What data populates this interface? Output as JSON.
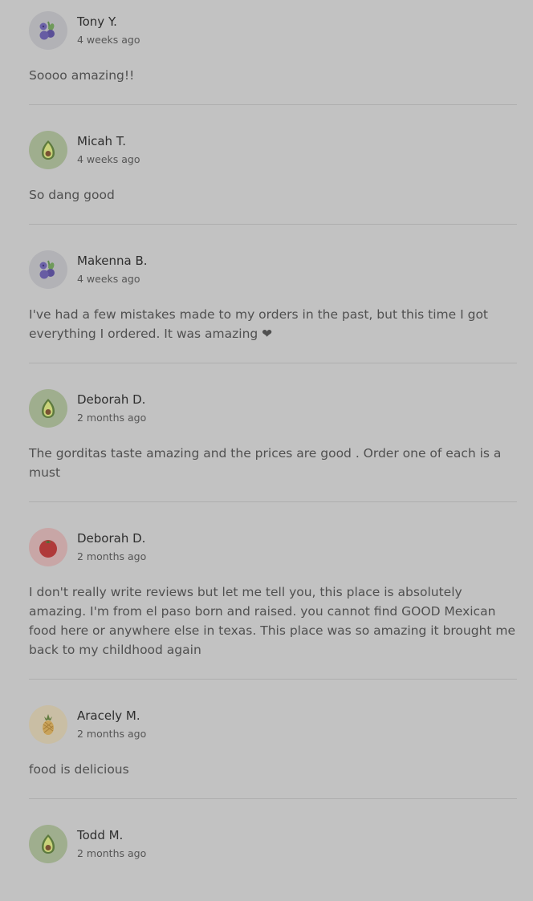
{
  "reviews": [
    {
      "name": "Tony Y.",
      "time": "4 weeks ago",
      "text": "Soooo amazing!!",
      "avatar": "blueberry-icon"
    },
    {
      "name": "Micah T.",
      "time": "4 weeks ago",
      "text": "So dang good",
      "avatar": "avocado-icon"
    },
    {
      "name": "Makenna B.",
      "time": "4 weeks ago",
      "text": "I've had a few mistakes made to my orders in the past, but this time I got everything I ordered. It was amazing ❤",
      "avatar": "blueberry-icon"
    },
    {
      "name": "Deborah D.",
      "time": "2 months ago",
      "text": "The gorditas taste amazing and the prices are good . Order one of each is a must",
      "avatar": "avocado-icon"
    },
    {
      "name": "Deborah D.",
      "time": "2 months ago",
      "text": "I don't really write reviews but let me tell you, this place is absolutely amazing. I'm from el paso born and raised. you cannot find GOOD Mexican food here or anywhere else in texas. This place was so amazing it brought me back to my childhood again",
      "avatar": "tomato-icon"
    },
    {
      "name": "Aracely M.",
      "time": "2 months ago",
      "text": "food is delicious",
      "avatar": "pineapple-icon"
    },
    {
      "name": "Todd M.",
      "time": "2 months ago",
      "text": "",
      "avatar": "avocado-icon"
    }
  ],
  "avatar_colors": {
    "blueberry_bg": "#b2b2b6",
    "avocado_bg": "#9fae8e",
    "tomato_bg": "#c8a6a6",
    "pineapple_bg": "#c9bea4"
  }
}
